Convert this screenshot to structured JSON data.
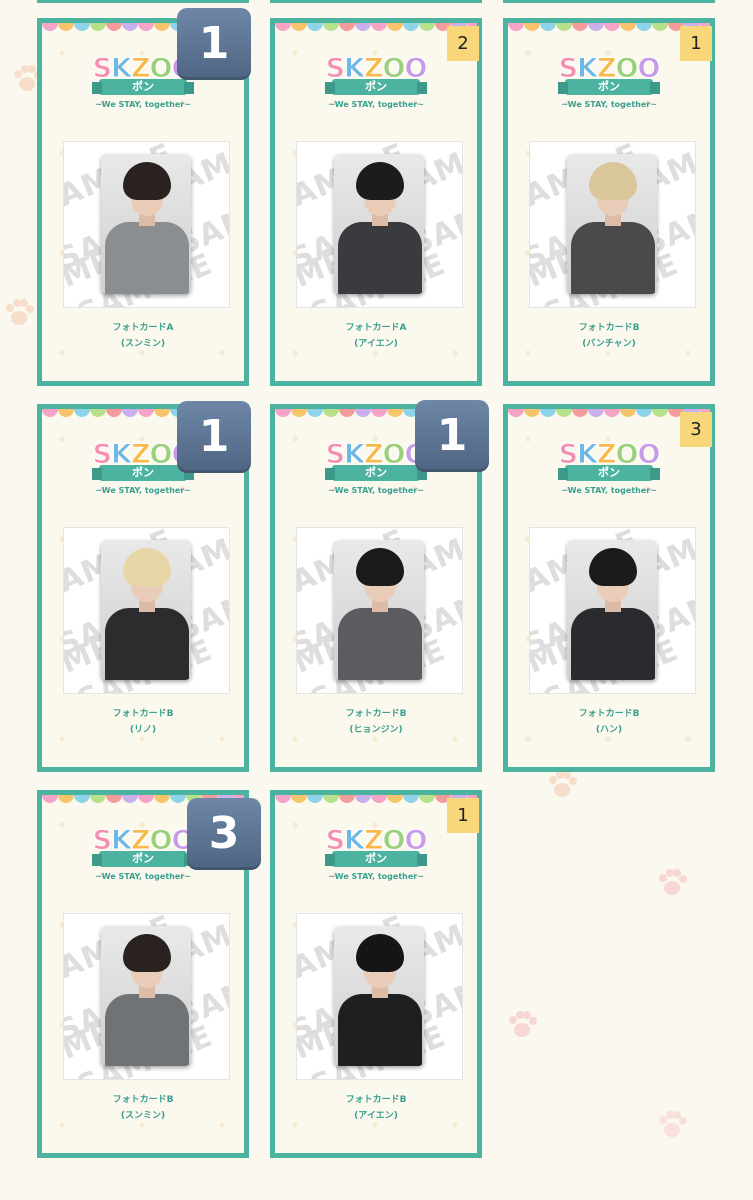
{
  "colors": {
    "border": "#4db3a1",
    "background": "#fbf8ef",
    "scallop": [
      "#f5a3c7",
      "#f7c46b",
      "#8fd3e8",
      "#b6e08a",
      "#f49b9b",
      "#c9b0ec"
    ],
    "big_badge": "#5b7393",
    "small_badge": "#f7d77a"
  },
  "logo": {
    "word": "SKZOO",
    "ribbon": "ポン",
    "subtitle": "~We STAY, together~"
  },
  "watermark": "SAMPLE",
  "cards": [
    {
      "label_line1": "フォトカードA",
      "label_line2": "(スンミン)",
      "count": "1",
      "badge_style": "big",
      "hair": "#2a2220",
      "outfit": "#8b8e91"
    },
    {
      "label_line1": "フォトカードA",
      "label_line2": "(アイエン)",
      "count": "2",
      "badge_style": "small",
      "hair": "#1c1b1d",
      "outfit": "#3a3b3f"
    },
    {
      "label_line1": "フォトカードB",
      "label_line2": "(バンチャン)",
      "count": "1",
      "badge_style": "small",
      "hair": "#d9c79b",
      "outfit": "#4a4a4c"
    },
    {
      "label_line1": "フォトカードB",
      "label_line2": "(リノ)",
      "count": "1",
      "badge_style": "big",
      "hair": "#e7d6a6",
      "outfit": "#2c2c2f"
    },
    {
      "label_line1": "フォトカードB",
      "label_line2": "(ヒョンジン)",
      "count": "1",
      "badge_style": "big",
      "hair": "#1a1a1c",
      "outfit": "#5a5c60"
    },
    {
      "label_line1": "フォトカードB",
      "label_line2": "(ハン)",
      "count": "3",
      "badge_style": "small",
      "hair": "#1b1a1c",
      "outfit": "#2a2b2e"
    },
    {
      "label_line1": "フォトカードB",
      "label_line2": "(スンミン)",
      "count": "3",
      "badge_style": "big",
      "hair": "#2a2220",
      "outfit": "#707376"
    },
    {
      "label_line1": "フォトカードB",
      "label_line2": "(アイエン)",
      "count": "1",
      "badge_style": "small",
      "hair": "#151416",
      "outfit": "#1f1f22"
    }
  ]
}
